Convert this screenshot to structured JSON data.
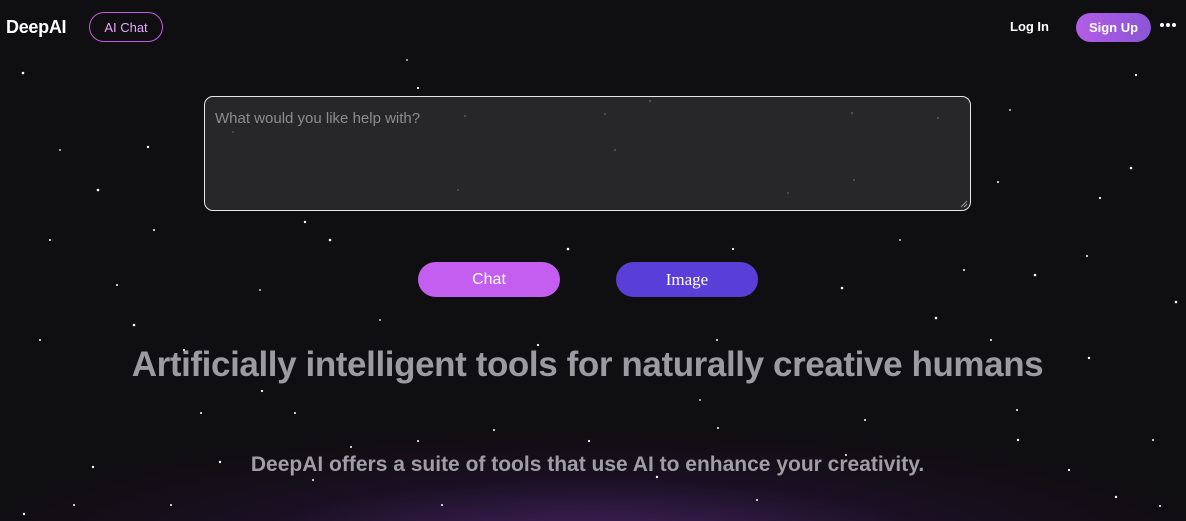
{
  "header": {
    "logo": "DeepAI",
    "ai_chat_label": "AI Chat",
    "login_label": "Log In",
    "signup_label": "Sign Up",
    "more_icon": "more-horizontal-icon"
  },
  "prompt": {
    "placeholder": "What would you like help with?",
    "value": ""
  },
  "actions": {
    "chat_label": "Chat",
    "image_label": "Image"
  },
  "hero": {
    "headline": "Artificially intelligent tools for naturally creative humans",
    "subline": "DeepAI offers a suite of tools that use AI to enhance your creativity."
  },
  "colors": {
    "background": "#0f0e10",
    "accent_purple": "#c45ef0",
    "accent_indigo": "#5a3ed8",
    "signup": "#b35de6"
  }
}
